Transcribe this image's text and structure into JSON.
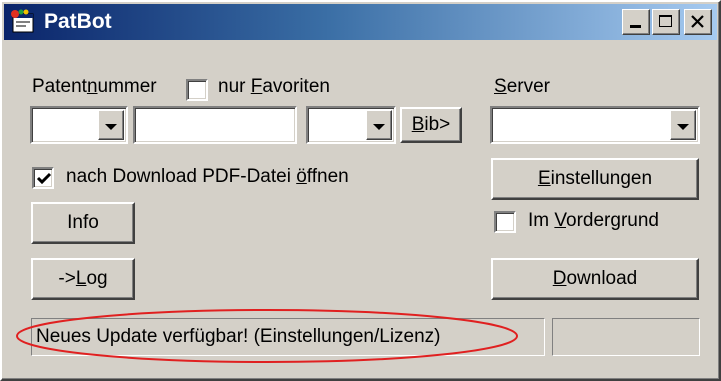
{
  "window": {
    "title": "PatBot",
    "controls": [
      "minimize-icon",
      "maximize-icon",
      "close-icon"
    ]
  },
  "patent": {
    "label_pre": "Patent",
    "label_key": "n",
    "label_post": "ummer",
    "country_value": "",
    "number_value": "",
    "kind_value": "",
    "bib_pre": "",
    "bib_key": "B",
    "bib_post": "ib>"
  },
  "favorites": {
    "label_pre": "nur ",
    "label_key": "F",
    "label_post": "avoriten",
    "checked": false
  },
  "server": {
    "label_pre": "",
    "label_key": "S",
    "label_post": "erver",
    "value": ""
  },
  "open_pdf": {
    "label_pre": "nach Download PDF-Datei ",
    "label_key": "ö",
    "label_post": "ffnen",
    "checked": true
  },
  "settings_button": {
    "key": "E",
    "rest": "instellungen"
  },
  "foreground": {
    "label_pre": "Im ",
    "label_key": "V",
    "label_post": "ordergrund",
    "checked": false
  },
  "info_button": {
    "label": "Info"
  },
  "log_button": {
    "pre": "-> ",
    "key": "L",
    "rest": "og"
  },
  "download_button": {
    "key": "D",
    "rest": "ownload"
  },
  "status": {
    "message": "Neues Update verfügbar! (Einstellungen/Lizenz)",
    "secondary": ""
  },
  "colors": {
    "face": "#d4d0c8",
    "title_start": "#0a246a",
    "title_end": "#a6caf0",
    "annotation": "#e02020"
  }
}
